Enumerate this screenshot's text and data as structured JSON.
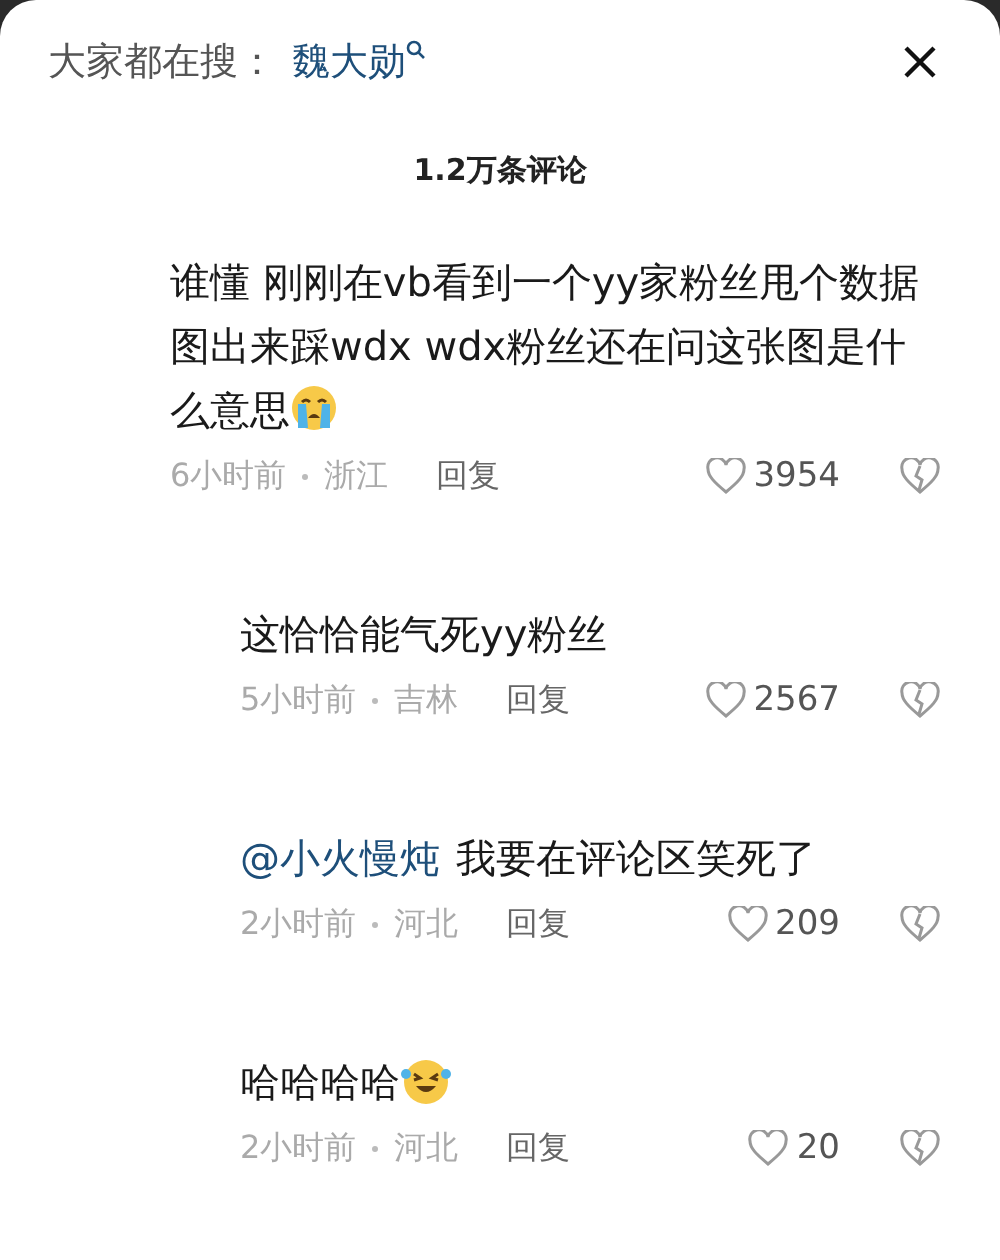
{
  "search_hint": {
    "label": "大家都在搜：",
    "query": "魏大勋"
  },
  "comment_count": "1.2万条评论",
  "comments": [
    {
      "kind": "crying",
      "text": "谁懂 刚刚在vb看到一个yy家粉丝甩个数据图出来踩wdx wdx粉丝还在问这张图是什么意思",
      "time": "6小时前",
      "location": "浙江",
      "reply": "回复",
      "likes": "3954",
      "children": [
        {
          "kind": "plain",
          "text": "这恰恰能气死yy粉丝",
          "time": "5小时前",
          "location": "吉林",
          "reply": "回复",
          "likes": "2567"
        },
        {
          "kind": "plain",
          "mention": "@小火慢炖",
          "text": "我要在评论区笑死了",
          "time": "2小时前",
          "location": "河北",
          "reply": "回复",
          "likes": "209"
        },
        {
          "kind": "laughing",
          "text": "哈哈哈哈",
          "time": "2小时前",
          "location": "河北",
          "reply": "回复",
          "likes": "20"
        }
      ]
    }
  ]
}
